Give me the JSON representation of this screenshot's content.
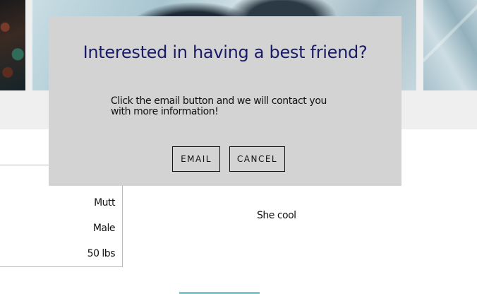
{
  "gallery": {
    "photos": [
      "dog-photo",
      "dog-photo",
      "dog-photo"
    ]
  },
  "details": {
    "breed": "Mutt",
    "sex": "Male",
    "weight": "50 lbs"
  },
  "description": "She cool",
  "modal": {
    "title": "Interested in having a best friend?",
    "body": "Click the email button and we will contact you with more information!",
    "email_label": "EMAIL",
    "cancel_label": "CANCEL"
  },
  "colors": {
    "modal_background": "#d3d3d3",
    "title_color": "#1a1a66",
    "accent_bar": "#7fc3cf",
    "gallery_background": "#efefef"
  }
}
